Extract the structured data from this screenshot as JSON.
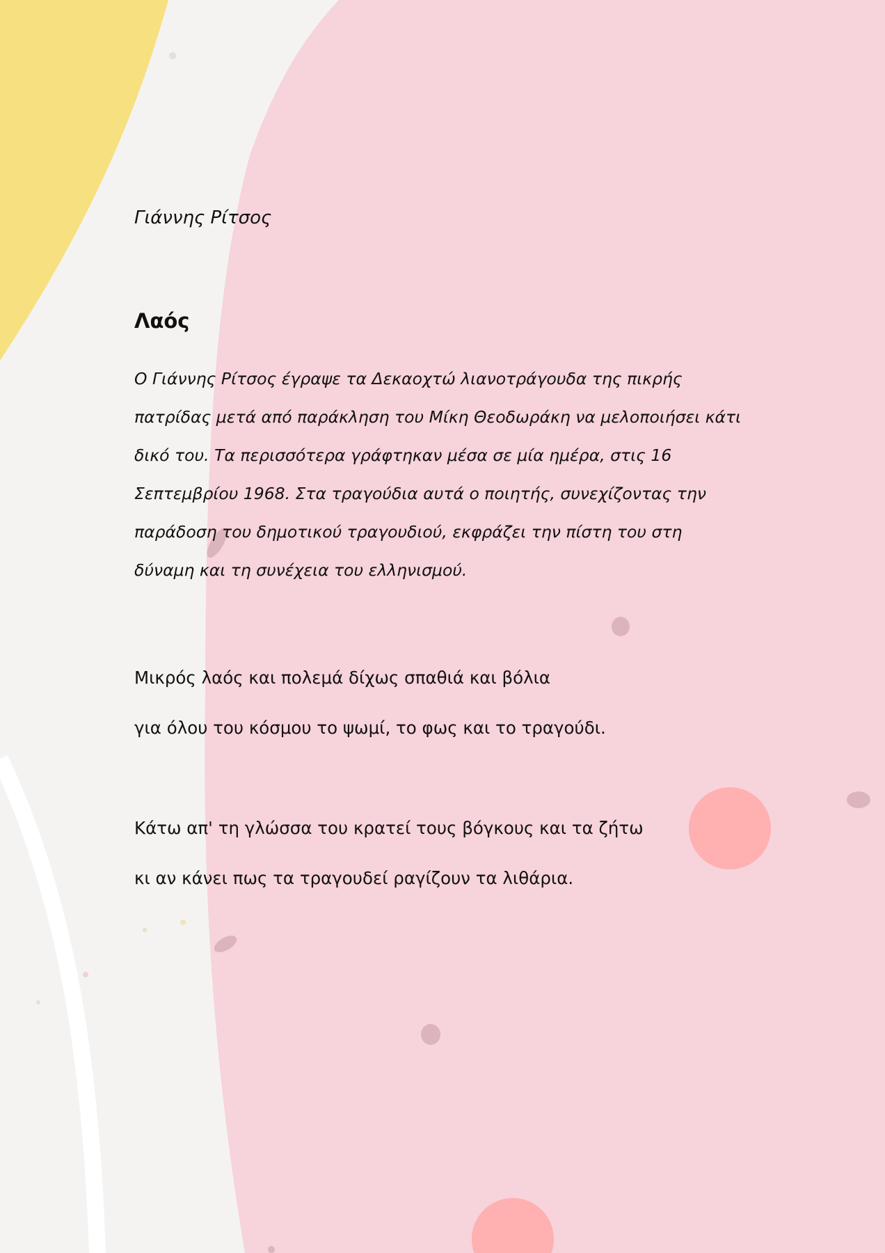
{
  "document": {
    "author": "Γιάννης Ρίτσος",
    "title": "Λαός",
    "intro": "Ο Γιάννης Ρίτσος έγραψε τα Δεκαοχτώ λιανοτράγουδα της πικρής πατρίδας μετά από παράκληση του Μίκη Θεοδωράκη να μελοποιήσει κάτι δικό του. Τα περισσότερα γράφτηκαν μέσα σε μία ημέρα, στις 16 Σεπτεμβρίου 1968. Στα τραγούδια αυτά ο ποιητής, συνεχίζοντας την παράδοση του δημοτικού τραγουδιού, εκφράζει την πίστη του στη δύναμη και τη συνέχεια του ελληνισμού.",
    "stanzas": [
      {
        "lines": [
          "Μικρός λαός και πολεμά δίχως σπαθιά και βόλια",
          "για όλου του κόσμου το ψωμί, το φως και το τραγούδι."
        ]
      },
      {
        "lines": [
          "Κάτω απ' τη γλώσσα του κρατεί τους βόγκους και τα ζήτω",
          "κι αν κάνει πως τα τραγουδεί ραγίζουν τα λιθάρια."
        ]
      }
    ]
  },
  "theme": {
    "background": "#f4f3f2",
    "pink": "#f7d3db",
    "yellow": "#f7e07f",
    "coral": "#ffb0b0",
    "speckle": "#dcb4bc",
    "text": "#111111"
  }
}
